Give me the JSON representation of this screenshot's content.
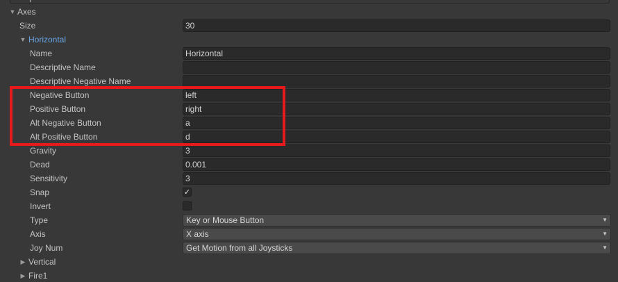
{
  "axes": {
    "label": "Axes",
    "size_label": "Size",
    "size_value": "30"
  },
  "horizontal": {
    "label": "Horizontal",
    "name_label": "Name",
    "name_value": "Horizontal",
    "descriptive_name_label": "Descriptive Name",
    "descriptive_name_value": "",
    "descriptive_negative_name_label": "Descriptive Negative Name",
    "descriptive_negative_name_value": "",
    "negative_button_label": "Negative Button",
    "negative_button_value": "left",
    "positive_button_label": "Positive Button",
    "positive_button_value": "right",
    "alt_negative_button_label": "Alt Negative Button",
    "alt_negative_button_value": "a",
    "alt_positive_button_label": "Alt Positive Button",
    "alt_positive_button_value": "d",
    "gravity_label": "Gravity",
    "gravity_value": "3",
    "dead_label": "Dead",
    "dead_value": "0.001",
    "sensitivity_label": "Sensitivity",
    "sensitivity_value": "3",
    "snap_label": "Snap",
    "snap_checked": true,
    "snap_mark": "✓",
    "invert_label": "Invert",
    "invert_checked": false,
    "type_label": "Type",
    "type_value": "Key or Mouse Button",
    "axis_label": "Axis",
    "axis_value": "X axis",
    "joy_num_label": "Joy Num",
    "joy_num_value": "Get Motion from all Joysticks"
  },
  "collapsed_items": [
    {
      "label": "Vertical"
    },
    {
      "label": "Fire1"
    }
  ],
  "icons": {
    "expanded": "▼",
    "collapsed": "▶",
    "dropdown": "▼"
  },
  "colors": {
    "background": "#383838",
    "highlight_box": "#e8191d",
    "selected_label": "#6aa6e8"
  }
}
